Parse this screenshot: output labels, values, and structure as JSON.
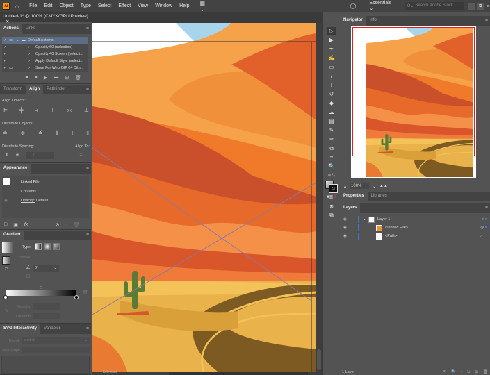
{
  "menubar": {
    "items": [
      "File",
      "Edit",
      "Object",
      "Type",
      "Select",
      "Effect",
      "View",
      "Window",
      "Help"
    ],
    "workspace": "Essentials",
    "search_placeholder": "Search Adobe Stock"
  },
  "document": {
    "tab_title": "Untitled-1* @ 100% (CMYK/GPU Preview)"
  },
  "actions_panel": {
    "tabs": [
      "Actions",
      "Links"
    ],
    "items": [
      "Default Actions",
      "Opacity 60 (selection)",
      "Opacity 40 Screen (selecti...",
      "Apply Default Style (select...",
      "Save For Web GIF 64 Dith..."
    ]
  },
  "align_panel": {
    "tabs": [
      "Transform",
      "Align",
      "Pathfinder"
    ],
    "align_objects": "Align Objects:",
    "distribute_objects": "Distribute Objects:",
    "distribute_spacing": "Distribute Spacing:",
    "align_to": "Align To:",
    "spacing_value": "0"
  },
  "appearance_panel": {
    "title": "Appearance",
    "object": "Linked File",
    "contents": "Contents",
    "opacity_label": "Opacity:",
    "opacity_value": "Default"
  },
  "gradient_panel": {
    "title": "Gradient",
    "type_label": "Type:",
    "stroke_label": "Stroke:",
    "angle": "0°",
    "opacity_label": "Opacity:",
    "location_label": "Location:"
  },
  "svg_panel": {
    "tabs": [
      "SVG Interactivity",
      "Variables"
    ],
    "event_label": "Event:",
    "event_value": "onclick",
    "js_label": "JavaScript:"
  },
  "status": {
    "tool": "Selection"
  },
  "navigator": {
    "tabs": [
      "Navigator",
      "Info"
    ],
    "zoom": "100%"
  },
  "properties": {
    "tabs": [
      "Properties",
      "Libraries"
    ]
  },
  "layers": {
    "title": "Layers",
    "items": [
      "Layer 1",
      "<Linked File>",
      "<Path>"
    ],
    "count": "1 Layer",
    "accent": "#4a6fd1"
  }
}
